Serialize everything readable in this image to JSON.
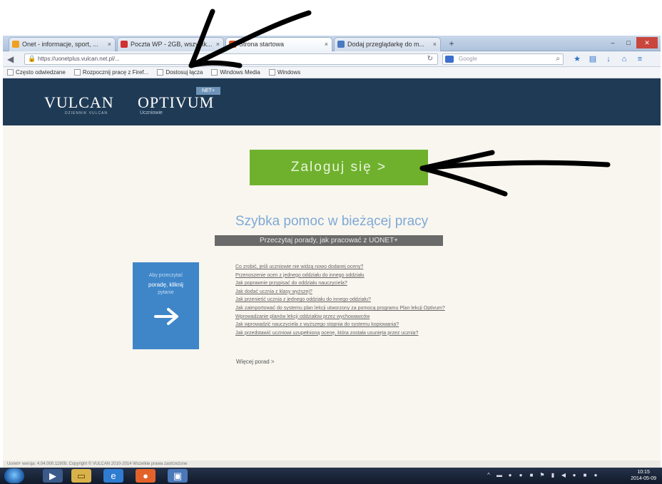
{
  "browser": {
    "tabs": [
      {
        "label": "Onet - informacje, sport, ...",
        "favicon_color": "#f0a020"
      },
      {
        "label": "Poczta WP - 2GB, wszystk...",
        "favicon_color": "#d03030"
      },
      {
        "label": "Strona startowa",
        "favicon_color": "#e05020"
      },
      {
        "label": "Dodaj przeglądarkę do m...",
        "favicon_color": "#4a7ac0"
      }
    ],
    "new_tab_label": "+",
    "url": "https://uonetplus.vulcan.net.pl/...",
    "search_placeholder": "Google",
    "bookmarks": [
      {
        "label": "Często odwiedzane"
      },
      {
        "label": "Rozpocznij pracę z Firef..."
      },
      {
        "label": "Dostosuj łącza"
      },
      {
        "label": "Windows Media"
      },
      {
        "label": "Windows"
      }
    ]
  },
  "header": {
    "vulcan_logo": "VULCAN",
    "vulcan_sub": "DZIENNIK VULCAN",
    "optivum_logo": "OPTIVUM",
    "optivum_badge": "NET+",
    "optivum_sub": "Uczniowie"
  },
  "main": {
    "login_button": "Zaloguj się >",
    "help_title": "Szybka pomoc w bieżącej pracy",
    "help_subtitle": "Przeczytaj porady, jak pracować z UONET+",
    "help_tile": {
      "line1": "Aby przeczytać",
      "line2": "poradę, kliknij",
      "line3": "pytanie"
    },
    "help_links": [
      "Co zrobić, jeśli uczniowie nie widzą nowo dodanej oceny?",
      "Przenoszenie ocen z jednego oddziału do innego oddziału",
      "Jak poprawnie przypisać do oddziału nauczyciela?",
      "Jak dodać ucznia z klasy wyższej?",
      "Jak przenieść ucznia z jednego oddziału do innego oddziału?",
      "Jak zaimportować do systemu plan lekcji utworzony za pomocą programu Plan lekcji Optivum?",
      "Wprowadzanie planów lekcji oddziałów przez wychowawców",
      "Jak wprowadzić nauczyciela z wyższego stopnia do systemu kopiowania?",
      "Jak przedstawić uczniowi uzupełnioną ocenę, która została usunięta przez ucznia?"
    ],
    "more_link": "Więcej porad >"
  },
  "footer": {
    "text": "Uonet+ wersja: 4.04.000.11909, Copyright © VULCAN 2010-2014 Wszelkie prawa zastrzeżone"
  },
  "taskbar": {
    "time": "10:15",
    "date": "2014-05-09"
  },
  "colors": {
    "header_bg": "#1f3a55",
    "login_green": "#6fb12d",
    "help_blue": "#3f86c9",
    "help_title_blue": "#7fa9d6"
  }
}
